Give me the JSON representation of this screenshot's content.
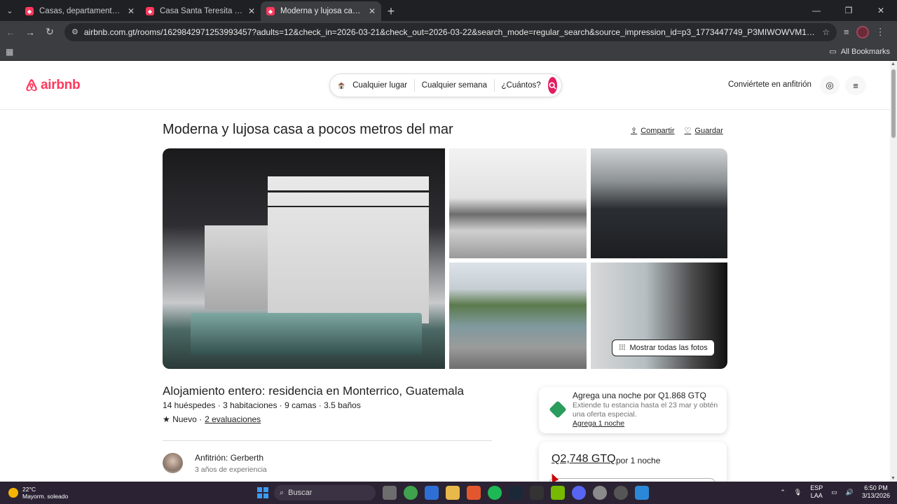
{
  "browser": {
    "tabs": [
      {
        "title": "Casas, departamentos y rentas vac",
        "active": false
      },
      {
        "title": "Casa Santa Teresita - Alojamientos",
        "active": false
      },
      {
        "title": "Moderna y lujosa casa a pocos me",
        "active": true
      }
    ],
    "url": "airbnb.com.gt/rooms/1629842971253993457?adults=12&check_in=2026-03-21&check_out=2026-03-22&search_mode=regular_search&source_impression_id=p3_1773447749_P3MIWOWVM1PjpcE&previous_page_section_name=10...",
    "all_bookmarks": "All Bookmarks"
  },
  "header": {
    "logo_text": "airbnb",
    "search": {
      "where": "Cualquier lugar",
      "when": "Cualquier semana",
      "who": "¿Cuántos?"
    },
    "host_link": "Conviértete en anfitrión"
  },
  "listing": {
    "title": "Moderna y lujosa casa a pocos metros del mar",
    "share": "Compartir",
    "save": "Guardar",
    "show_all_photos": "Mostrar todas las fotos",
    "subtitle": "Alojamiento entero: residencia en Monterrico, Guatemala",
    "details": "14 huéspedes · 3 habitaciones · 9 camas · 3.5 baños",
    "rating_new": "★ Nuevo ·",
    "reviews": "2 evaluaciones",
    "host_name": "Anfitrión: Gerberth",
    "host_experience": "3 años de experiencia"
  },
  "promo": {
    "title": "Agrega una noche por Q1.868 GTQ",
    "description": "Extiende tu estancia hasta el 23 mar y obtén una oferta especial.",
    "link": "Agrega 1 noche"
  },
  "booking": {
    "price": "Q2,748 GTQ",
    "per_night": "por 1 noche"
  },
  "taskbar": {
    "temperature": "22°C",
    "weather": "Mayorm. soleado",
    "search": "Buscar",
    "lang1": "ESP",
    "lang2": "LAA",
    "time": "6:50 PM",
    "date": "3/13/2026"
  },
  "colors": {
    "brand": "#ff385c",
    "search_button": "#e31c5f",
    "promo_tag": "#2a9d5c"
  }
}
